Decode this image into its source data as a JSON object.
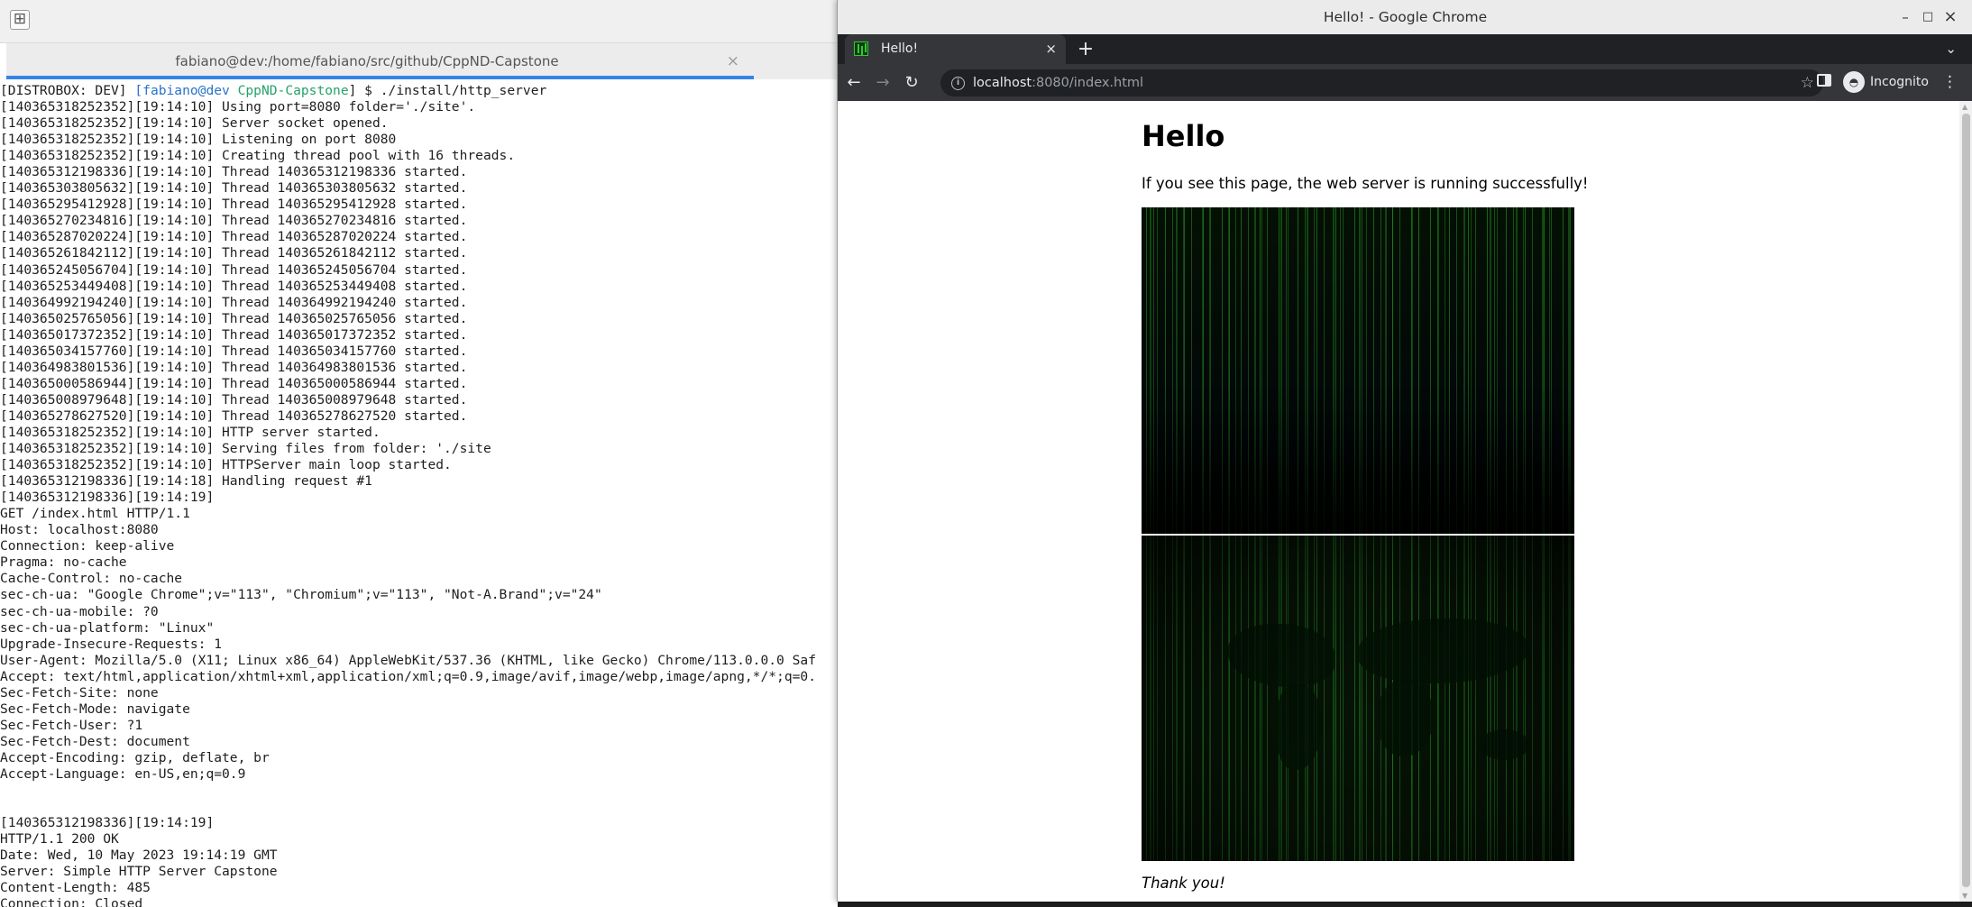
{
  "terminal": {
    "new_tab_icon": "new-tab-icon",
    "tab_title": "fabiano@dev:/home/fabiano/src/github/CppND-Capstone",
    "tab_close": "×",
    "prompt": {
      "prefix": "[DISTROBOX: DEV] ",
      "host": "[fabiano@dev",
      "dir": " CppND-Capstone",
      "suffix": "] $ ./install/http_server"
    },
    "lines": [
      "[140365318252352][19:14:10] Using port=8080 folder='./site'.",
      "[140365318252352][19:14:10] Server socket opened.",
      "[140365318252352][19:14:10] Listening on port 8080",
      "[140365318252352][19:14:10] Creating thread pool with 16 threads.",
      "[140365312198336][19:14:10] Thread 140365312198336 started.",
      "[140365303805632][19:14:10] Thread 140365303805632 started.",
      "[140365295412928][19:14:10] Thread 140365295412928 started.",
      "[140365270234816][19:14:10] Thread 140365270234816 started.",
      "[140365287020224][19:14:10] Thread 140365287020224 started.",
      "[140365261842112][19:14:10] Thread 140365261842112 started.",
      "[140365245056704][19:14:10] Thread 140365245056704 started.",
      "[140365253449408][19:14:10] Thread 140365253449408 started.",
      "[140364992194240][19:14:10] Thread 140364992194240 started.",
      "[140365025765056][19:14:10] Thread 140365025765056 started.",
      "[140365017372352][19:14:10] Thread 140365017372352 started.",
      "[140365034157760][19:14:10] Thread 140365034157760 started.",
      "[140364983801536][19:14:10] Thread 140364983801536 started.",
      "[140365000586944][19:14:10] Thread 140365000586944 started.",
      "[140365008979648][19:14:10] Thread 140365008979648 started.",
      "[140365278627520][19:14:10] Thread 140365278627520 started.",
      "[140365318252352][19:14:10] HTTP server started.",
      "[140365318252352][19:14:10] Serving files from folder: './site",
      "[140365318252352][19:14:10] HTTPServer main loop started.",
      "[140365312198336][19:14:18] Handling request #1",
      "[140365312198336][19:14:19]",
      "GET /index.html HTTP/1.1",
      "Host: localhost:8080",
      "Connection: keep-alive",
      "Pragma: no-cache",
      "Cache-Control: no-cache",
      "sec-ch-ua: \"Google Chrome\";v=\"113\", \"Chromium\";v=\"113\", \"Not-A.Brand\";v=\"24\"",
      "sec-ch-ua-mobile: ?0",
      "sec-ch-ua-platform: \"Linux\"",
      "Upgrade-Insecure-Requests: 1",
      "User-Agent: Mozilla/5.0 (X11; Linux x86_64) AppleWebKit/537.36 (KHTML, like Gecko) Chrome/113.0.0.0 Saf",
      "Accept: text/html,application/xhtml+xml,application/xml;q=0.9,image/avif,image/webp,image/apng,*/*;q=0.",
      "Sec-Fetch-Site: none",
      "Sec-Fetch-Mode: navigate",
      "Sec-Fetch-User: ?1",
      "Sec-Fetch-Dest: document",
      "Accept-Encoding: gzip, deflate, br",
      "Accept-Language: en-US,en;q=0.9",
      "",
      "",
      "[140365312198336][19:14:19]",
      "HTTP/1.1 200 OK",
      "Date: Wed, 10 May 2023 19:14:19 GMT",
      "Server: Simple HTTP Server Capstone",
      "Content-Length: 485",
      "Connection: Closed"
    ]
  },
  "chrome": {
    "window_title": "Hello! - Google Chrome",
    "window_controls": {
      "minimize": "–",
      "maximize": "□",
      "close": "×"
    },
    "tab": {
      "title": "Hello!",
      "close": "×",
      "favicon": "matrix-favicon-icon"
    },
    "new_tab": "+",
    "tab_list": "⌄",
    "nav": {
      "back": "←",
      "forward": "→",
      "reload": "↻"
    },
    "url": {
      "host": "localhost",
      "rest": ":8080/index.html",
      "info_icon": "i"
    },
    "star": "☆",
    "incognito_label": "Incognito",
    "incognito_avatar": "◓",
    "menu": "⋮",
    "page": {
      "heading": "Hello",
      "intro": "If you see this page, the web server is running successfully!",
      "images": [
        "matrix-code-rain-image",
        "matrix-world-map-image"
      ],
      "thanks": "Thank you!"
    }
  },
  "colors": {
    "terminal_bg": "#ffffff",
    "prompt_host": "#2b73c8",
    "prompt_dir": "#26a269",
    "chrome_dark": "#35363a",
    "tab_indicator": "#3584e4",
    "matrix_green": "#39c53c"
  }
}
